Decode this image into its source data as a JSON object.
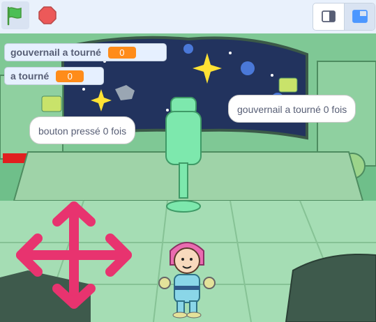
{
  "toolbar": {
    "green_flag_icon": "green-flag-icon",
    "stop_icon": "stop-sign-icon",
    "small_stage_icon": "small-stage-layout-icon",
    "normal_stage_icon": "normal-stage-layout-icon",
    "colors": {
      "flag": "#4cbf56",
      "stop": "#ec5959",
      "active_bg": "#d9e3f2"
    }
  },
  "monitors": [
    {
      "label": "gouvernail a tourné",
      "value": "0"
    },
    {
      "label": "a tourné",
      "value": "0"
    }
  ],
  "bubbles": {
    "left": "bouton pressé 0 fois",
    "right": "gouvernail a tourné 0 fois"
  },
  "sprites": {
    "arrows_icon": "four-way-arrows-icon",
    "astronaut": "astronaut-sprite",
    "arrow_color": "#e8336f",
    "backdrop_color": "#6fbf8a"
  }
}
